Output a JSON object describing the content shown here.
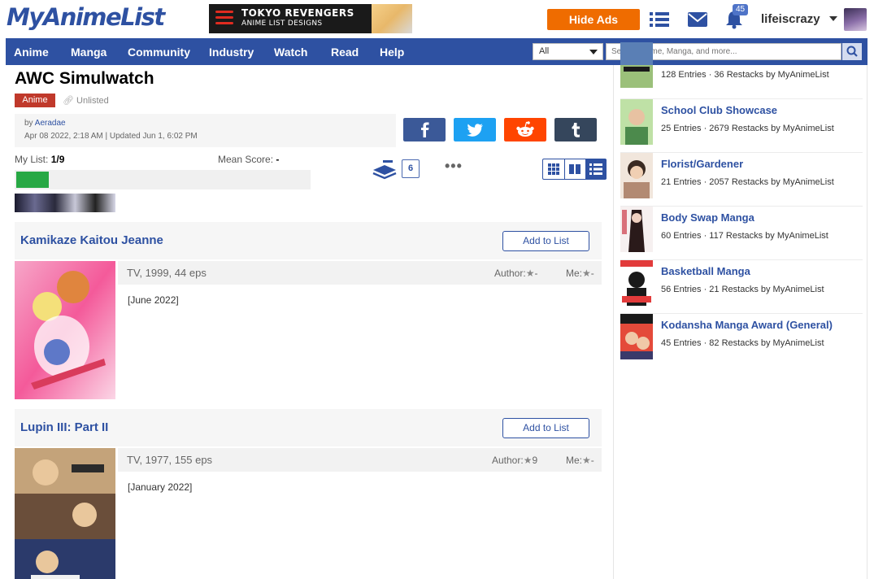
{
  "header": {
    "logo": "MyAnimeList",
    "banner_title": "TOKYO REVENGERS",
    "banner_subtitle": "ANIME LIST DESIGNS",
    "hide_ads": "Hide Ads",
    "notification_count": "45",
    "username": "lifeiscrazy"
  },
  "nav": {
    "items": [
      "Anime",
      "Manga",
      "Community",
      "Industry",
      "Watch",
      "Read",
      "Help"
    ],
    "search_category": "All",
    "search_placeholder": "Search Anime, Manga, and more..."
  },
  "page": {
    "title": "AWC Simulwatch",
    "type_badge": "Anime",
    "visibility": "Unlisted",
    "by_label": "by",
    "author": "Aeradae",
    "dates": "Apr 08 2022, 2:18 AM | Updated Jun 1, 6:02 PM",
    "my_list_label": "My List:",
    "my_list_value": "1/9",
    "progress_fraction": 0.111,
    "mean_score_label": "Mean Score:",
    "mean_score_value": "-",
    "restack_count": "6",
    "more": "•••"
  },
  "share": {
    "colors": {
      "facebook": "#3b5998",
      "twitter": "#1da1f2",
      "reddit": "#ff4500",
      "tumblr": "#35465c"
    }
  },
  "entries": [
    {
      "title": "Kamikaze Kaitou Jeanne",
      "add_label": "Add to List",
      "info": "TV, 1999, 44 eps",
      "author_label": "Author:",
      "author_score": "-",
      "me_label": "Me:",
      "me_score": "-",
      "note": "[June 2022]"
    },
    {
      "title": "Lupin III: Part II",
      "add_label": "Add to List",
      "info": "TV, 1977, 155 eps",
      "author_label": "Author:",
      "author_score": "9",
      "me_label": "Me:",
      "me_score": "-",
      "note": "[January 2022]"
    }
  ],
  "sidebar": {
    "items": [
      {
        "title": "",
        "meta": "128 Entries · 36 Restacks   by   MyAnimeList"
      },
      {
        "title": "School Club Showcase",
        "meta": "25 Entries · 2679 Restacks   by   MyAnimeList"
      },
      {
        "title": "Florist/Gardener",
        "meta": "21 Entries · 2057 Restacks   by   MyAnimeList"
      },
      {
        "title": "Body Swap Manga",
        "meta": "60 Entries · 117 Restacks   by   MyAnimeList"
      },
      {
        "title": "Basketball Manga",
        "meta": "56 Entries · 21 Restacks   by   MyAnimeList"
      },
      {
        "title": "Kodansha Manga Award (General)",
        "meta": "45 Entries · 82 Restacks   by   MyAnimeList"
      }
    ]
  }
}
